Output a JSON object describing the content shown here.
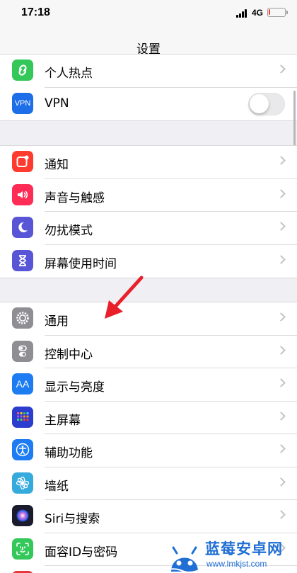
{
  "status_bar": {
    "time": "17:18",
    "network": "4G",
    "battery_level": 0.1
  },
  "nav": {
    "title": "设置"
  },
  "groups": [
    {
      "items": [
        {
          "label": "个人热点",
          "icon": "link-icon",
          "color": "#34c759",
          "accessory": "chevron"
        },
        {
          "label": "VPN",
          "icon": "vpn-icon",
          "icon_text": "VPN",
          "color": "#1d6ee8",
          "accessory": "toggle",
          "toggle_on": false
        }
      ]
    },
    {
      "items": [
        {
          "label": "通知",
          "icon": "notifications-icon",
          "color": "#ff3b30",
          "accessory": "chevron"
        },
        {
          "label": "声音与触感",
          "icon": "speaker-icon",
          "color": "#ff2d55",
          "accessory": "chevron"
        },
        {
          "label": "勿扰模式",
          "icon": "moon-icon",
          "color": "#5856d6",
          "accessory": "chevron"
        },
        {
          "label": "屏幕使用时间",
          "icon": "hourglass-icon",
          "color": "#5856d6",
          "accessory": "chevron"
        }
      ]
    },
    {
      "items": [
        {
          "label": "通用",
          "icon": "gear-icon",
          "color": "#8e8e93",
          "accessory": "chevron"
        },
        {
          "label": "控制中心",
          "icon": "switches-icon",
          "color": "#8e8e93",
          "accessory": "chevron"
        },
        {
          "label": "显示与亮度",
          "icon": "text-size-icon",
          "icon_text": "AA",
          "color": "#1d7cf2",
          "accessory": "chevron"
        },
        {
          "label": "主屏幕",
          "icon": "home-screen-icon",
          "color": "#2c3ccf",
          "accessory": "chevron"
        },
        {
          "label": "辅助功能",
          "icon": "accessibility-icon",
          "color": "#1d7cf2",
          "accessory": "chevron"
        },
        {
          "label": "墙纸",
          "icon": "flower-icon",
          "color": "#35aadc",
          "accessory": "chevron"
        },
        {
          "label": "Siri与搜索",
          "icon": "siri-icon",
          "color": "#1b1b2e",
          "accessory": "chevron"
        },
        {
          "label": "面容ID与密码",
          "icon": "face-id-icon",
          "color": "#34c759",
          "accessory": "chevron"
        }
      ]
    }
  ],
  "watermark": {
    "title": "蓝莓安卓网",
    "url": "www.lmkjst.com"
  },
  "colors": {
    "background": "#efeff4",
    "annotation_arrow": "#e8202a"
  }
}
